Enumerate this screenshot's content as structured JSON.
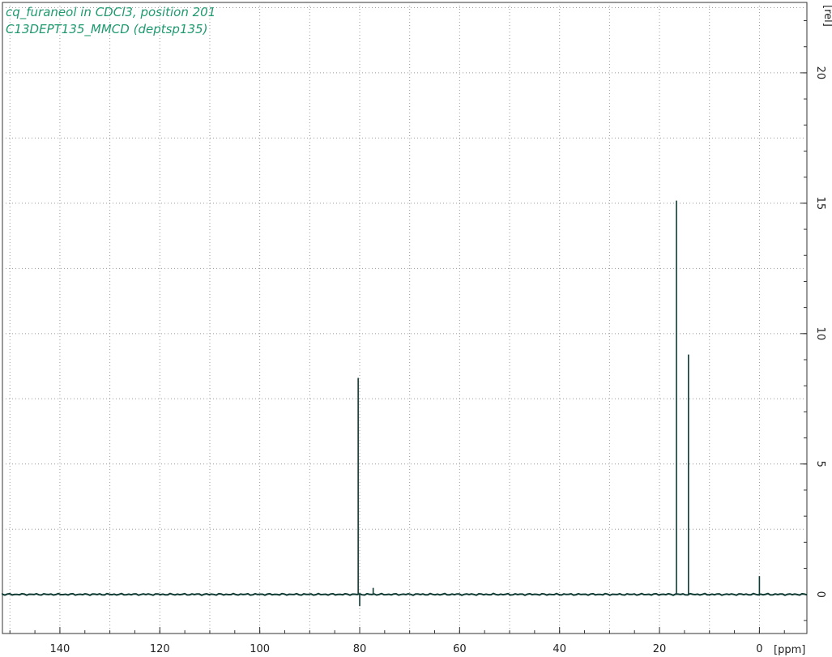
{
  "header": {
    "title_line1": "cq_furaneol in CDCl3, position 201",
    "title_line2": "C13DEPT135_MMCD (deptsp135)"
  },
  "colors": {
    "title": "#1f9a6e",
    "spectrum": "#0f3b34",
    "grid": "#9a9a9a",
    "axis": "#333333"
  },
  "chart_data": {
    "type": "line",
    "title": "cq_furaneol in CDCl3, position 201",
    "subtitle": "C13DEPT135_MMCD (deptsp135)",
    "xlabel": "[ppm]",
    "ylabel": "[rel]",
    "xlim": [
      151.5,
      -9.5
    ],
    "ylim": [
      -1.5,
      22.7
    ],
    "x_reversed": true,
    "x_ticks": [
      140,
      120,
      100,
      80,
      60,
      40,
      20,
      0
    ],
    "y_ticks": [
      0,
      5,
      10,
      15,
      20
    ],
    "grid": true,
    "legend": "none",
    "peaks": [
      {
        "x": 80.3,
        "y": 8.3
      },
      {
        "x": 77.3,
        "y": 0.25
      },
      {
        "x": 80.0,
        "y": -0.45
      },
      {
        "x": 16.6,
        "y": 15.1
      },
      {
        "x": 14.2,
        "y": 9.2
      },
      {
        "x": 0.0,
        "y": 0.7
      }
    ]
  }
}
